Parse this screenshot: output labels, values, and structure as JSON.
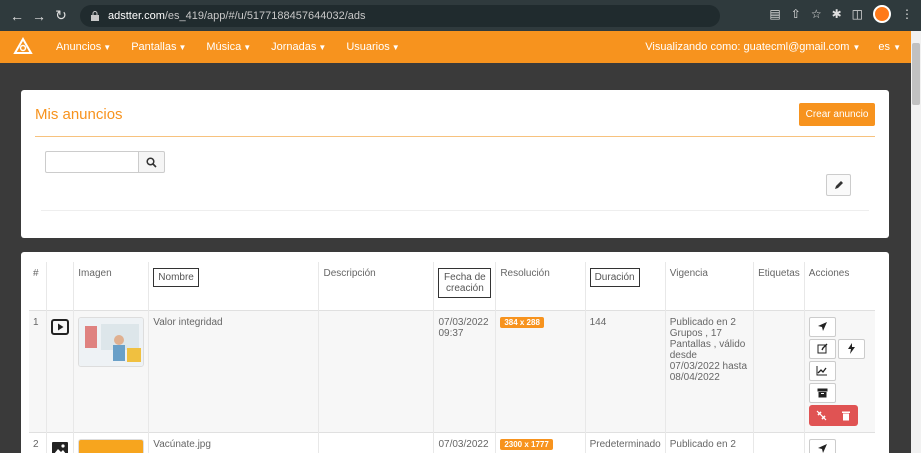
{
  "browser": {
    "url_domain": "adstter.com",
    "url_path": "/es_419/app/#/u/5177188457644032/ads"
  },
  "navbar": {
    "menus": [
      "Anuncios",
      "Pantallas",
      "Música",
      "Jornadas",
      "Usuarios"
    ],
    "user_text": "Visualizando como: guatecml@gmail.com",
    "language": "es"
  },
  "header_panel": {
    "title": "Mis anuncios",
    "create_label": "Crear anuncio",
    "search_value": ""
  },
  "table": {
    "columns": [
      "#",
      "",
      "Imagen",
      "Nombre",
      "Descripción",
      "Fecha de creación",
      "Resolución",
      "Duración",
      "Vigencia",
      "Etiquetas",
      "Acciones"
    ],
    "rows": [
      {
        "num": "1",
        "type_icon": "play-icon",
        "name": "Valor integridad",
        "description": "",
        "created": "07/03/2022 09:37",
        "resolution": "384 x 288",
        "duration": "144",
        "validity": "Publicado en 2 Grupos , 17 Pantallas , válido desde 07/03/2022 hasta 08/04/2022",
        "tags": ""
      },
      {
        "num": "2",
        "type_icon": "image-icon",
        "name": "Vacúnate.jpg",
        "description": "",
        "created": "07/03/2022",
        "resolution": "2300 x 1777",
        "duration": "Predeterminado",
        "validity": "Publicado en 2",
        "tags": ""
      }
    ]
  },
  "colors": {
    "brand": "#f7931e",
    "danger": "#e05353"
  }
}
